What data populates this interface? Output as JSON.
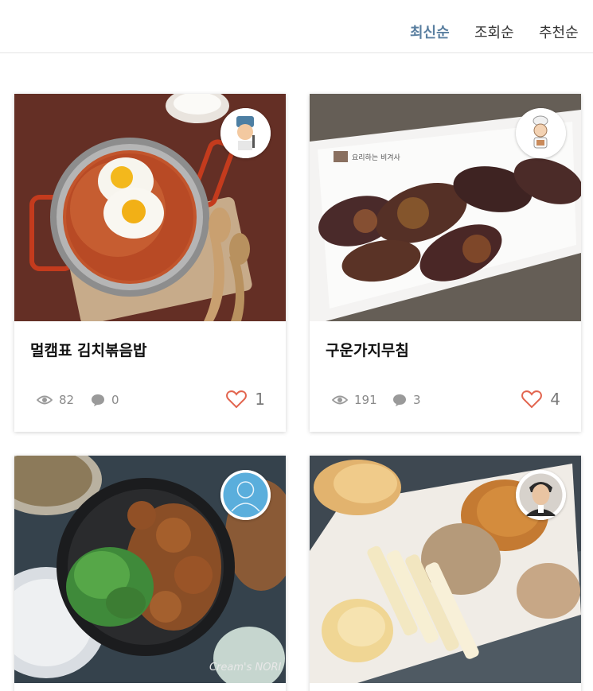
{
  "sort_tabs": [
    {
      "label": "최신순",
      "active": true
    },
    {
      "label": "조회순",
      "active": false
    },
    {
      "label": "추천순",
      "active": false
    }
  ],
  "recipes": [
    {
      "title": "멀캠표 김치볶음밥",
      "views": "82",
      "comments": "0",
      "likes": "1",
      "avatar": "chef-illustration-avatar"
    },
    {
      "title": "구운가지무침",
      "views": "191",
      "comments": "3",
      "likes": "4",
      "avatar": "cook-illustration-avatar"
    },
    {
      "title": "",
      "views": "",
      "comments": "",
      "likes": "",
      "avatar": "default-user-avatar"
    },
    {
      "title": "",
      "views": "",
      "comments": "",
      "likes": "",
      "avatar": "chef-photo-avatar"
    }
  ],
  "photo_captions": {
    "card2_watermark": "요리하는 비겨사",
    "card3_watermark": "Cream's NORI"
  },
  "colors": {
    "active_tab": "#5a7fa0",
    "heart": "#e2654f",
    "muted": "#8a8a8a"
  }
}
